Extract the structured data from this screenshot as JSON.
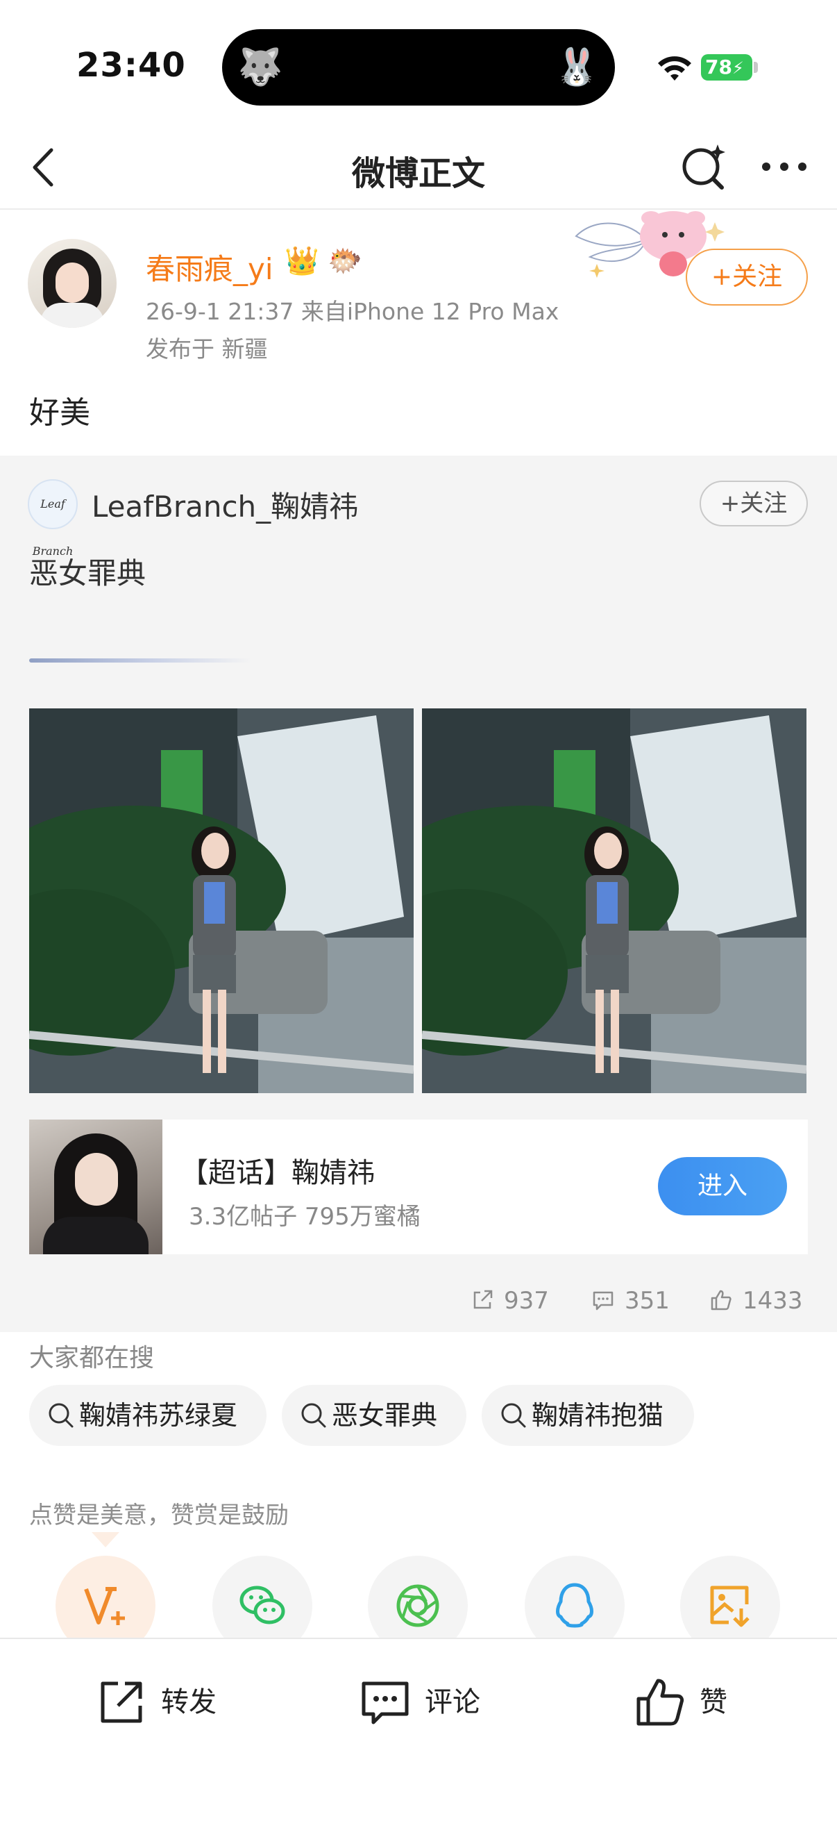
{
  "status_bar": {
    "time": "23:40",
    "battery": "78",
    "island_left_icon": "🐺",
    "island_right_icon": "🐰"
  },
  "nav": {
    "title": "微博正文",
    "back_icon": "chevron-left-icon",
    "search_icon": "search-sparkle-icon",
    "more_icon": "more-icon"
  },
  "post": {
    "username": "春雨痕_yi",
    "badges": [
      "👑",
      "🐡"
    ],
    "timestamp": "26-9-1 21:37",
    "source": "来自iPhone 12 Pro Max",
    "location": "发布于 新疆",
    "follow_label": "+关注",
    "text": "好美"
  },
  "repost": {
    "author": "LeafBranch_鞠婧祎",
    "avatar_text": "Leaf Branch",
    "follow_label": "+关注",
    "text": "恶女罪典",
    "topic": {
      "title": "【超话】鞠婧祎",
      "subtitle": "3.3亿帖子 795万蜜橘",
      "enter_label": "进入"
    },
    "stats": {
      "reposts": "937",
      "comments": "351",
      "likes": "1433"
    }
  },
  "search": {
    "title": "大家都在搜",
    "chips": [
      "鞠婧祎苏绿夏",
      "恶女罪典",
      "鞠婧祎抱猫"
    ]
  },
  "appreciate": {
    "text": "点赞是美意，赞赏是鼓励",
    "share_icons": [
      "reward-icon",
      "wechat-icon",
      "moments-icon",
      "qq-icon",
      "save-image-icon"
    ]
  },
  "toolbar": {
    "repost_label": "转发",
    "comment_label": "评论",
    "like_label": "赞"
  },
  "colors": {
    "accent_orange": "#f57b19",
    "enter_blue": "#3c8ff0",
    "battery_green": "#34c759"
  }
}
